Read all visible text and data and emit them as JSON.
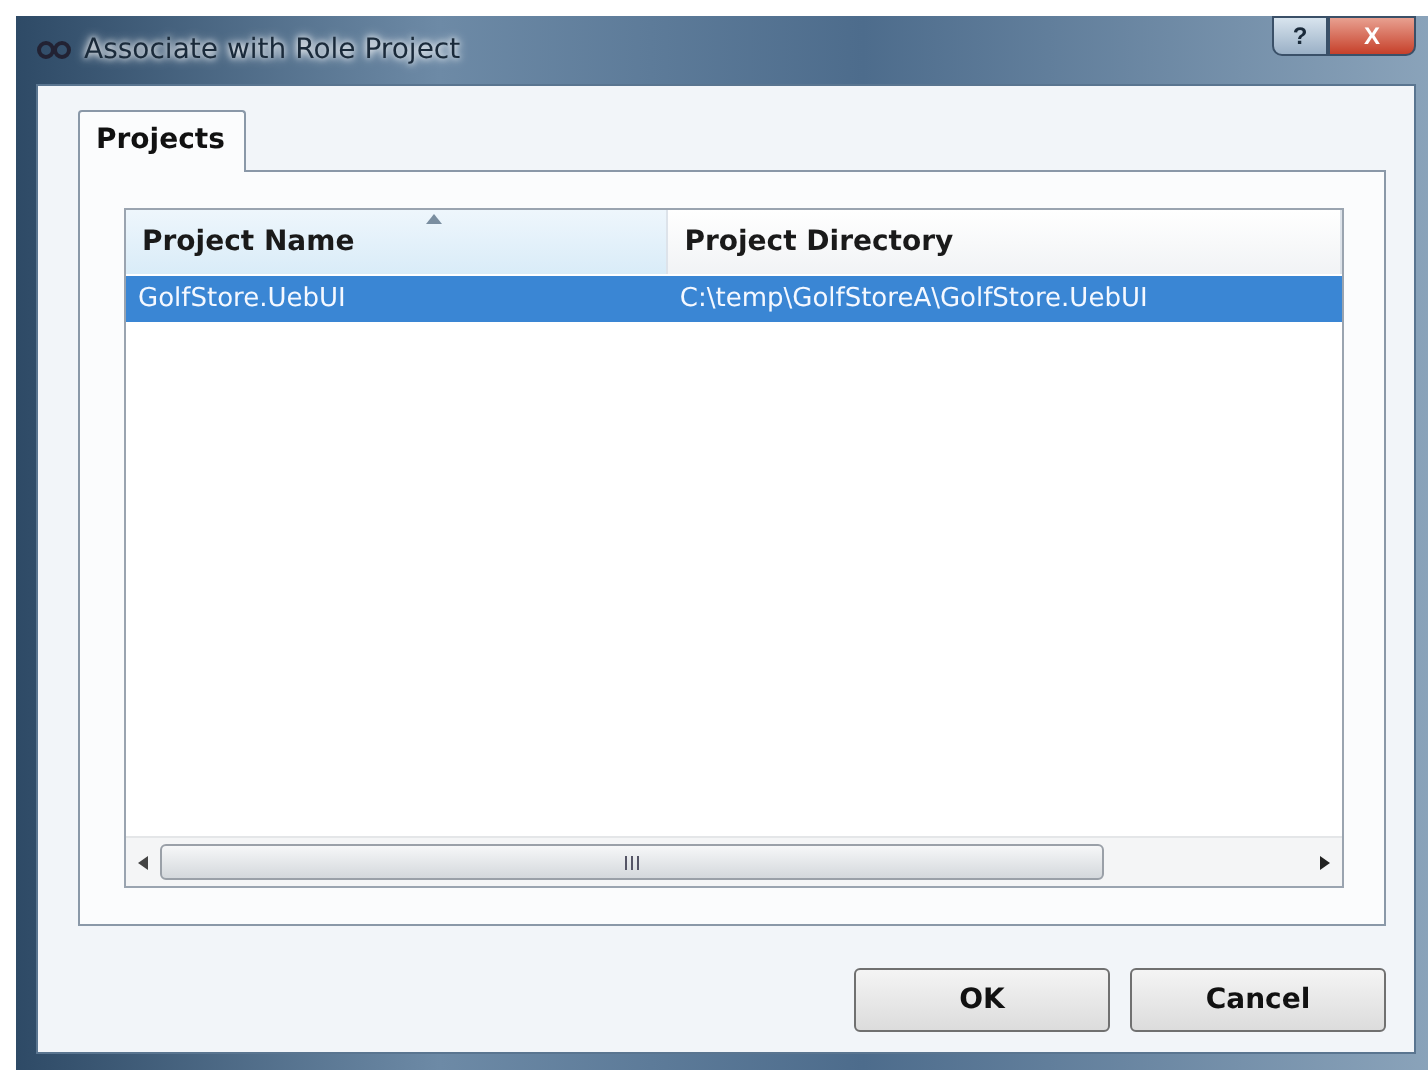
{
  "window": {
    "title": "Associate with Role Project",
    "caption_buttons": [
      {
        "label": "?",
        "kind": "help"
      },
      {
        "label": "X",
        "kind": "close"
      }
    ]
  },
  "tabs": [
    {
      "label": "Projects",
      "selected": true
    }
  ],
  "table": {
    "columns": [
      {
        "label": "Project Name",
        "sorted": true
      },
      {
        "label": "Project Directory",
        "sorted": false
      }
    ],
    "rows": [
      {
        "cells": [
          "GolfStore.UebUI",
          "C:\\temp\\GolfStoreA\\GolfStore.UebUI"
        ],
        "selected": true
      }
    ]
  },
  "buttons": [
    "OK",
    "Cancel"
  ]
}
